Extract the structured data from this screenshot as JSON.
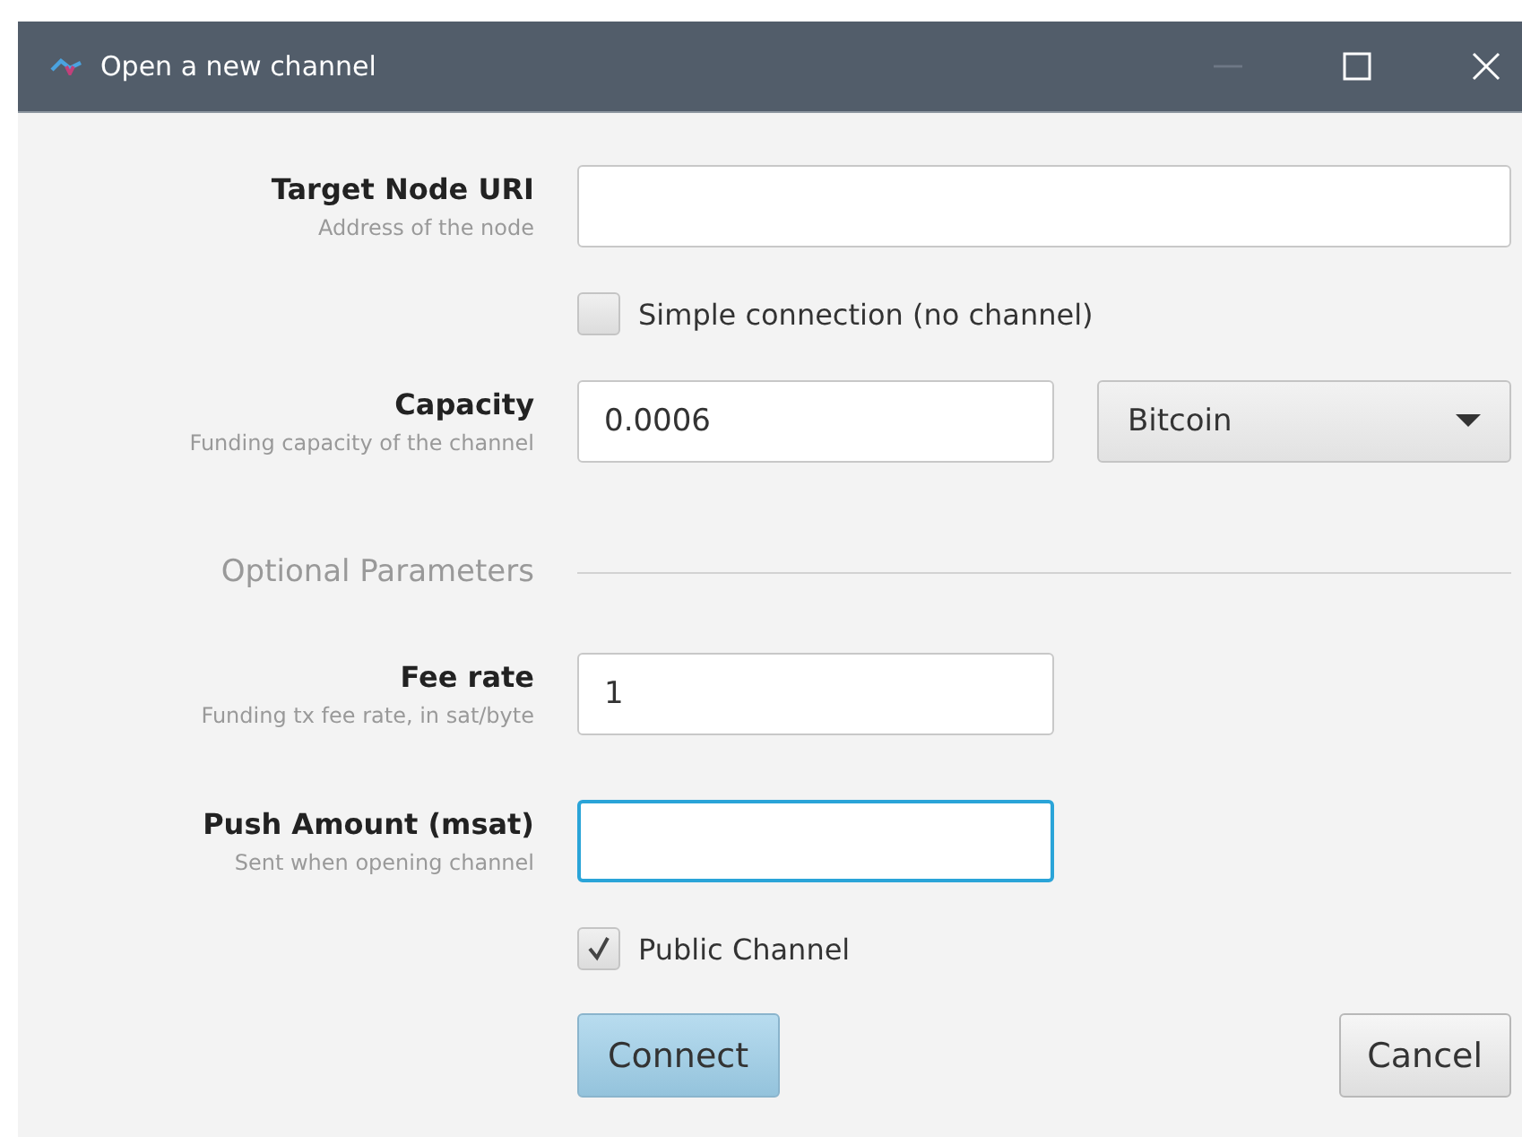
{
  "window": {
    "title": "Open a new channel"
  },
  "rows": [
    {
      "kind": "wide",
      "label": "Target Node URI",
      "hint": "Address of the node",
      "value": "",
      "focused": false
    },
    {
      "kind": "checkbox",
      "label": "Simple connection (no channel)",
      "checked": false
    },
    {
      "kind": "amount",
      "label": "Capacity",
      "hint": "Funding capacity of the channel",
      "value": "0.0006",
      "unit": "Bitcoin"
    },
    {
      "kind": "section",
      "label": "Optional Parameters"
    },
    {
      "kind": "text",
      "label": "Fee rate",
      "hint": "Funding tx fee rate, in sat/byte",
      "value": "1",
      "focused": false
    },
    {
      "kind": "text",
      "label": "Push Amount (msat)",
      "hint": "Sent when opening channel",
      "value": "",
      "focused": true
    },
    {
      "kind": "checkbox",
      "label": "Public Channel",
      "checked": true
    }
  ],
  "buttons": [
    {
      "label": "Connect",
      "kind": "primary"
    },
    {
      "label": "Cancel",
      "kind": "default"
    }
  ]
}
